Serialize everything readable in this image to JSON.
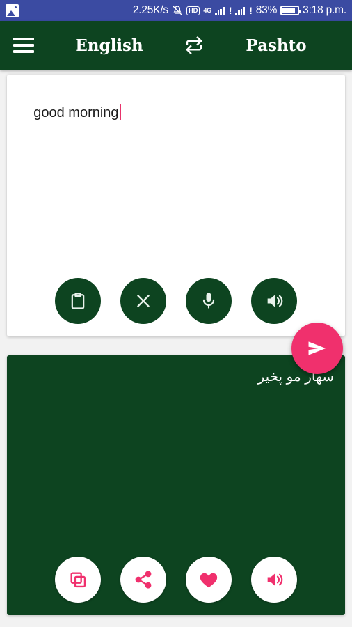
{
  "status_bar": {
    "background": "#3b4ba2",
    "gallery_icon": "image-icon",
    "network_speed": "2.25K/s",
    "mute_icon": "bell-muted-icon",
    "hd_label": "HD",
    "network_type": "4G",
    "signal1_icon": "signal-bars-icon",
    "signal1_alert": "!",
    "signal2_icon": "signal-bars-icon",
    "signal2_alert": "!",
    "battery_percent": "83%",
    "battery_icon": "battery-icon",
    "clock": "3:18 p.m."
  },
  "app_bar": {
    "background": "#0d4420",
    "menu_icon": "hamburger-menu-icon",
    "source_language": "English",
    "swap_icon": "swap-languages-icon",
    "target_language": "Pashto"
  },
  "input_card": {
    "background": "#ffffff",
    "text": "good morning",
    "caret_color": "#e8336b",
    "actions": [
      {
        "name": "paste-button",
        "icon": "clipboard-icon",
        "label": "Paste"
      },
      {
        "name": "clear-button",
        "icon": "close-x-icon",
        "label": "Clear"
      },
      {
        "name": "voice-input-button",
        "icon": "microphone-icon",
        "label": "Speak"
      },
      {
        "name": "speak-input-button",
        "icon": "speaker-icon",
        "label": "Listen"
      }
    ]
  },
  "send_button": {
    "icon": "send-icon",
    "color": "#f0306d",
    "label": "Translate"
  },
  "output_card": {
    "background": "#0d4420",
    "text": "سهار مو پخیر",
    "actions": [
      {
        "name": "copy-button",
        "icon": "copy-icon",
        "label": "Copy"
      },
      {
        "name": "share-button",
        "icon": "share-icon",
        "label": "Share"
      },
      {
        "name": "favorite-button",
        "icon": "heart-icon",
        "label": "Favorite"
      },
      {
        "name": "speak-output-button",
        "icon": "speaker-icon",
        "label": "Listen"
      }
    ]
  },
  "accent_colors": {
    "green": "#0d4420",
    "pink": "#f0306d",
    "status_blue": "#3b4ba2"
  }
}
